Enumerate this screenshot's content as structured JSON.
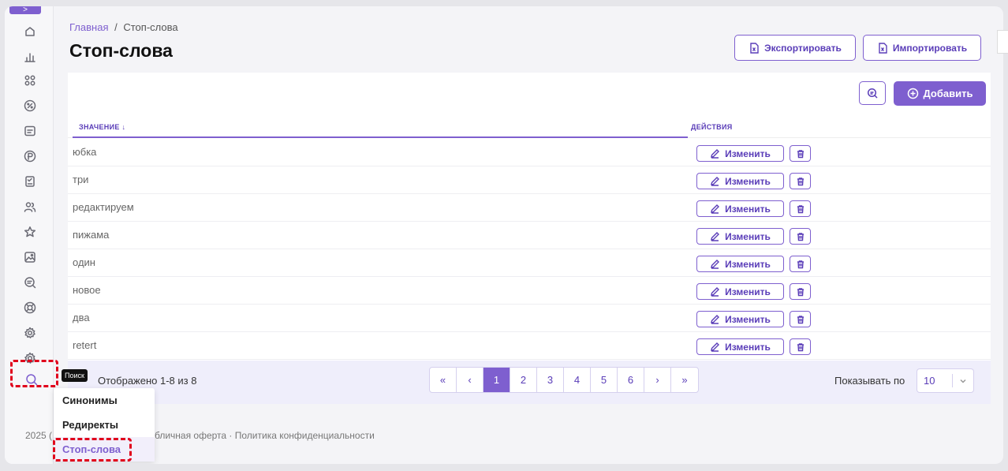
{
  "breadcrumb": {
    "home": "Главная",
    "separator": "/",
    "current": "Стоп-слова"
  },
  "page_title": "Стоп-слова",
  "header_buttons": {
    "export": "Экспортировать",
    "import": "Импортировать"
  },
  "toolbar": {
    "add": "Добавить"
  },
  "table": {
    "columns": {
      "value": "ЗНАЧЕНИЕ ↓",
      "actions": "ДЕЙСТВИЯ"
    },
    "edit_label": "Изменить",
    "rows": [
      "юбка",
      "три",
      "редактируем",
      "пижама",
      "один",
      "новое",
      "два",
      "retert"
    ]
  },
  "footer": {
    "shown_prefix": "Отображено 1-8 из 8",
    "pages": [
      "«",
      "‹",
      "1",
      "2",
      "3",
      "4",
      "5",
      "6",
      "›",
      "»"
    ],
    "active_page": "1",
    "per_page_label": "Показывать по",
    "per_page_value": "10"
  },
  "tooltip": "Поиск",
  "flyout": {
    "items": [
      "Синонимы",
      "Редиректы",
      "Стоп-слова"
    ],
    "active": "Стоп-слова"
  },
  "page_footer": {
    "copyright": "2025 (",
    "legal": "бличная оферта  ·  Политика конфиденциальности"
  },
  "sidebar": {
    "toggle": ">",
    "icons": [
      "home-icon",
      "chart-icon",
      "grid-icon",
      "percent-icon",
      "message-icon",
      "coin-icon",
      "checklist-icon",
      "users-icon",
      "star-icon",
      "image-icon",
      "search-list-icon",
      "lifebuoy-icon",
      "settings-icon",
      "settings-alt-icon",
      "search-icon"
    ]
  },
  "colors": {
    "accent": "#7e5fcf",
    "highlight_dash": "#e0001b"
  }
}
